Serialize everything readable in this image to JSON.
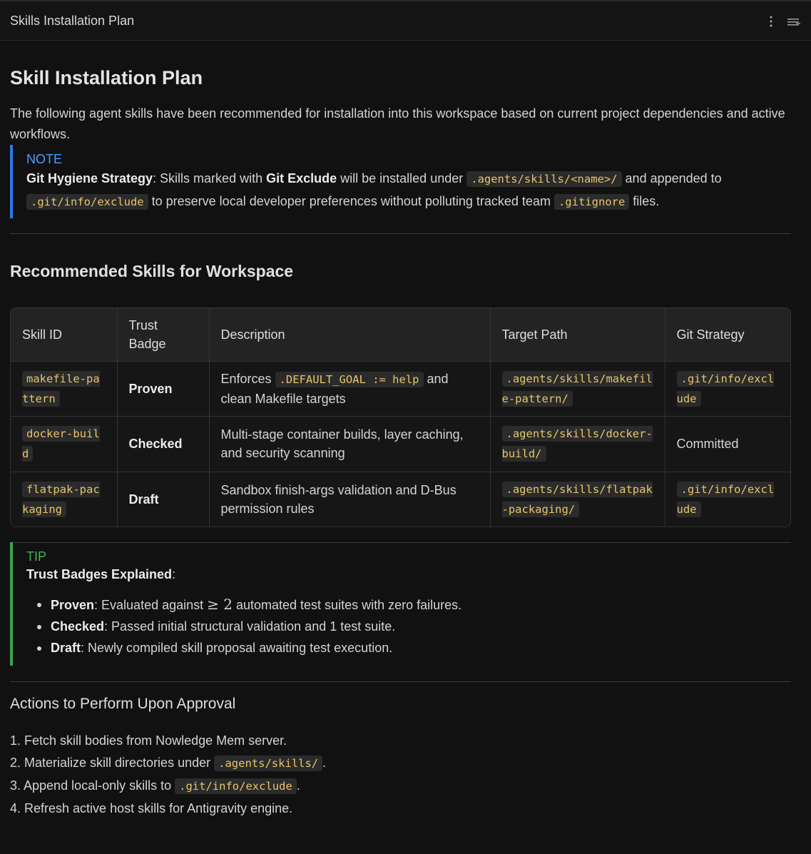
{
  "window": {
    "title": "Skills Installation Plan"
  },
  "plan": {
    "heading": "Skill Installation Plan",
    "intro": "The following agent skills have been recommended for installation into this workspace based on current project dependencies and active workflows."
  },
  "note": {
    "label": "NOTE",
    "strategy_label": "Git Hygiene Strategy",
    "text_1": ": Skills marked with ",
    "git_exclude": "Git Exclude",
    "text_2": " will be installed under ",
    "path_skills": ".agents/skills/<name>/",
    "text_3": " and appended to ",
    "path_exclude": ".git/info/exclude",
    "text_4": " to preserve local developer preferences without polluting tracked team ",
    "gitignore": ".gitignore",
    "text_5": " files."
  },
  "skills_section": {
    "heading": "Recommended Skills for Workspace",
    "columns": [
      "Skill ID",
      "Trust Badge",
      "Description",
      "Target Path",
      "Git Strategy"
    ],
    "rows": [
      {
        "skill_id": "makefile-pattern",
        "badge": "Proven",
        "desc_pre": "Enforces ",
        "desc_code": ".DEFAULT_GOAL := help",
        "desc_post": " and clean Makefile targets",
        "target_path": ".agents/skills/makefile-pattern/",
        "git_strategy": ".git/info/exclude"
      },
      {
        "skill_id": "docker-build",
        "badge": "Checked",
        "desc_pre": "Multi-stage container builds, layer caching, and security scanning",
        "desc_code": "",
        "desc_post": "",
        "target_path": ".agents/skills/docker-build/",
        "git_strategy": "Committed"
      },
      {
        "skill_id": "flatpak-packaging",
        "badge": "Draft",
        "desc_pre": "Sandbox finish-args validation and D-Bus permission rules",
        "desc_code": "",
        "desc_post": "",
        "target_path": ".agents/skills/flatpak-packaging/",
        "git_strategy": ".git/info/exclude"
      }
    ]
  },
  "tip": {
    "label": "TIP",
    "title": "Trust Badges Explained",
    "title_suffix": ":",
    "items": [
      {
        "term": "Proven",
        "text_pre": ": Evaluated against ",
        "math": "≥ 2",
        "text_post": " automated test suites with zero failures."
      },
      {
        "term": "Checked",
        "text": ": Passed initial structural validation and 1 test suite."
      },
      {
        "term": "Draft",
        "text": ": Newly compiled skill proposal awaiting test execution."
      }
    ]
  },
  "actions": {
    "heading": "Actions to Perform Upon Approval",
    "items": [
      {
        "pre": "1. Fetch skill bodies from Nowledge Mem server.",
        "code": "",
        "post": ""
      },
      {
        "pre": "2. Materialize skill directories under ",
        "code": ".agents/skills/",
        "post": "."
      },
      {
        "pre": "3. Append local-only skills to ",
        "code": ".git/info/exclude",
        "post": "."
      },
      {
        "pre": "4. Refresh active host skills for Antigravity engine.",
        "code": "",
        "post": ""
      }
    ]
  }
}
